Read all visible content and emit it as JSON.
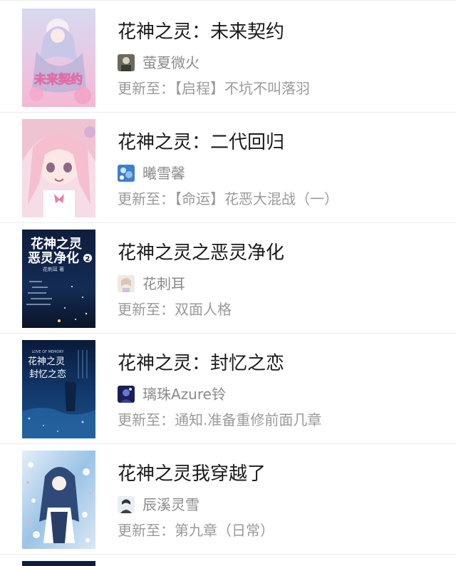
{
  "books": [
    {
      "title": "花神之灵：未来契约",
      "author": "萤夏微火",
      "update_label": "更新至：",
      "update_text": "【启程】不坑不叫落羽",
      "cover_icon": "book-cover-pink-anime",
      "avatar_icon": "author-avatar"
    },
    {
      "title": "花神之灵：二代回归",
      "author": "曦雪馨",
      "update_label": "更新至：",
      "update_text": "【命运】花恶大混战（一）",
      "cover_icon": "book-cover-pink-girl",
      "avatar_icon": "author-avatar"
    },
    {
      "title": "花神之灵之恶灵净化",
      "author": "花刺耳",
      "update_label": "更新至：",
      "update_text": "双面人格",
      "cover_icon": "book-cover-night-sky",
      "avatar_icon": "author-avatar"
    },
    {
      "title": "花神之灵：封忆之恋",
      "author": "璃珠Azure铃",
      "update_label": "更新至：",
      "update_text": "通知.准备重修前面几章",
      "cover_icon": "book-cover-blue-night",
      "avatar_icon": "author-avatar"
    },
    {
      "title": "花神之灵我穿越了",
      "author": "辰溪灵雪",
      "update_label": "更新至：",
      "update_text": "第九章（日常）",
      "cover_icon": "book-cover-blue-flowers",
      "avatar_icon": "author-avatar"
    }
  ],
  "cover_texts": {
    "book1": "未来契约",
    "book3_line1": "花神之灵",
    "book3_line2": "恶灵净化",
    "book3_num": "2",
    "book3_author": "花刺耳 著",
    "book4_top": "LOVE OF MEMORY",
    "book4_line1": "花神之灵",
    "book4_line2": "封忆之恋"
  },
  "colors": {
    "title": "#1a1a1a",
    "meta": "#9a9a9a",
    "divider": "#ececec"
  }
}
